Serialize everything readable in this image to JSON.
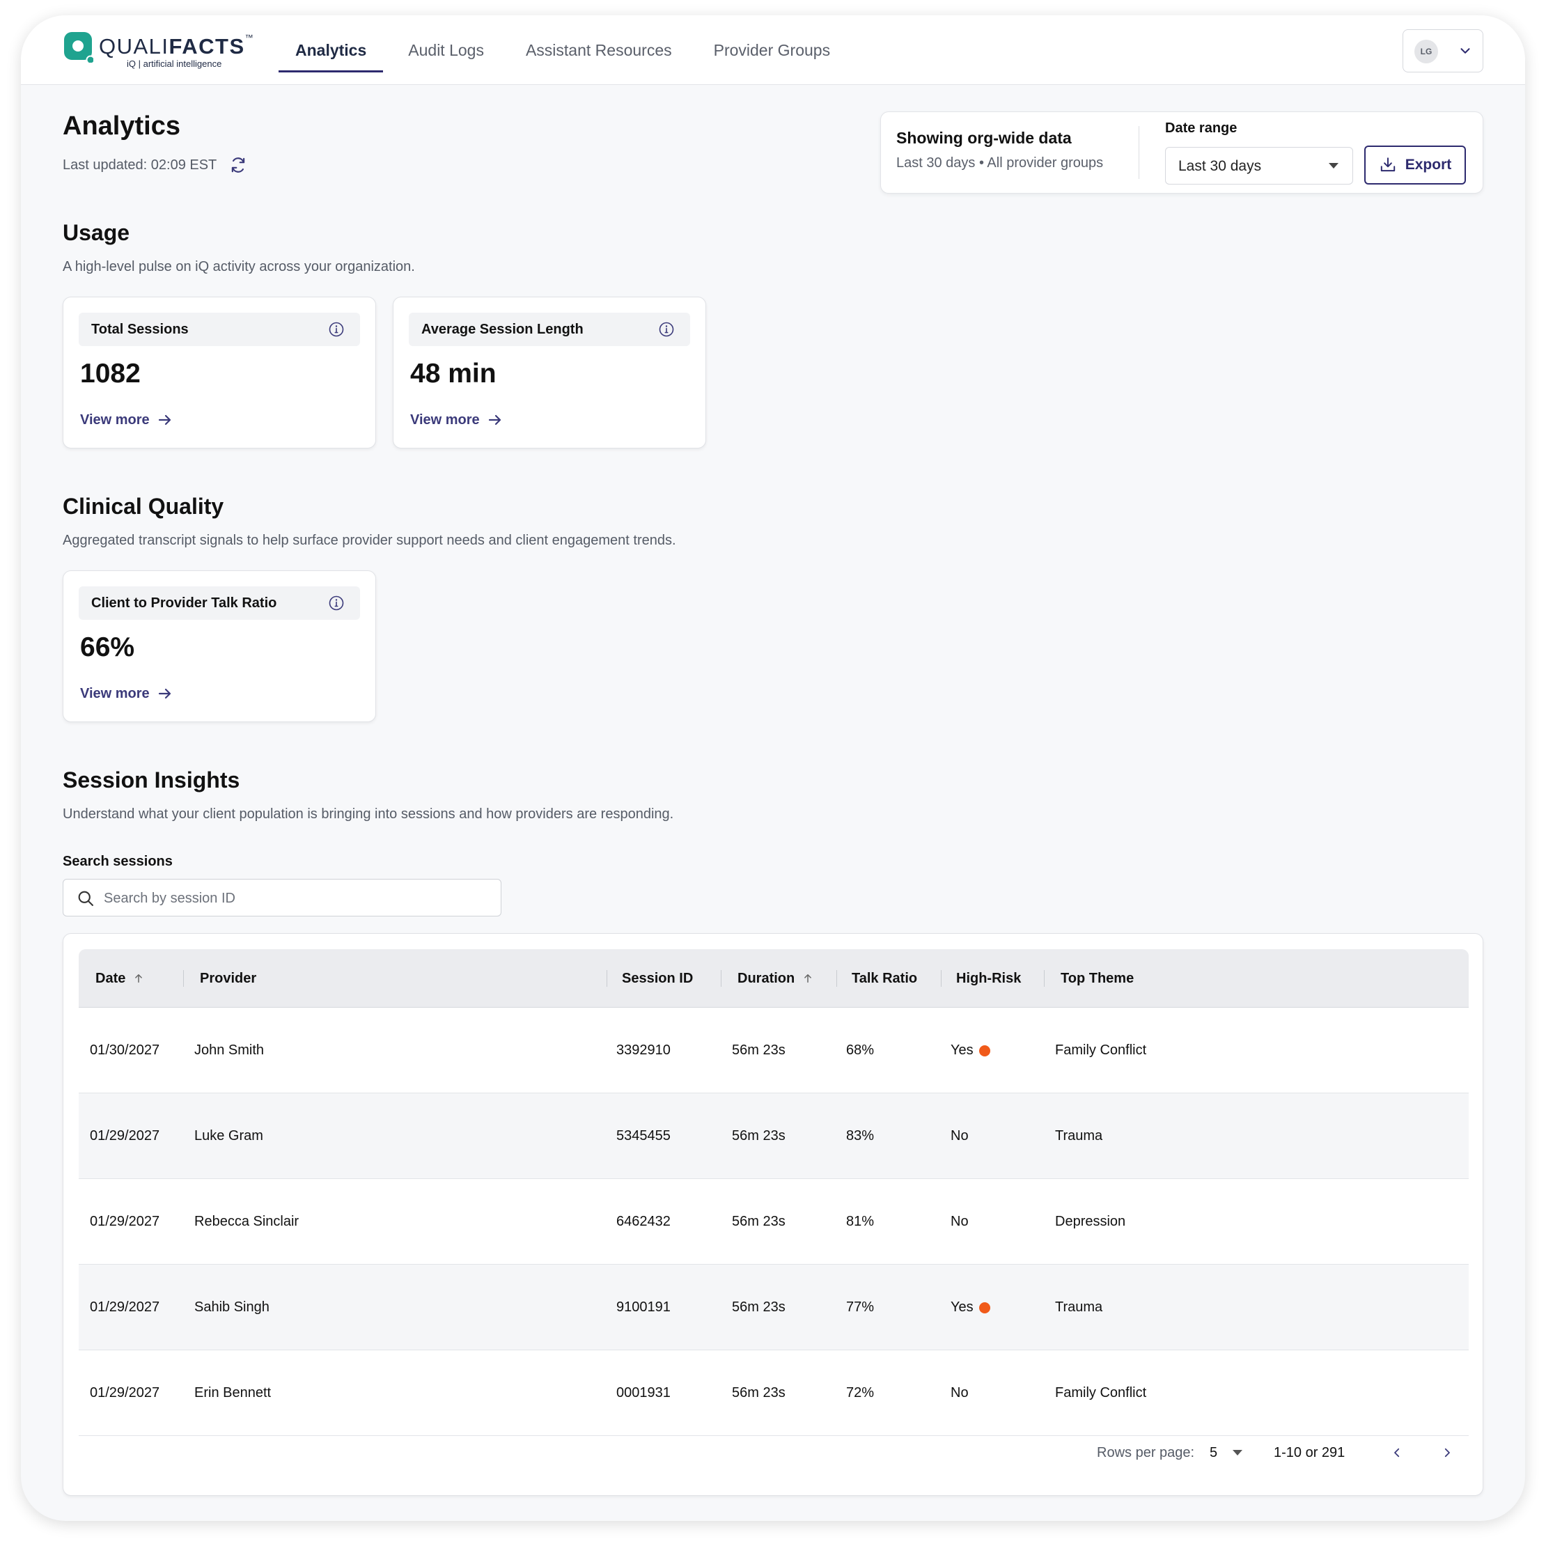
{
  "brand": {
    "name_light": "QUALI",
    "name_bold": "FACTS",
    "trademark": "™",
    "tagline": "iQ | artificial intelligence",
    "accent": "#1fa38f"
  },
  "nav": {
    "tabs": [
      {
        "label": "Analytics",
        "active": true
      },
      {
        "label": "Audit Logs",
        "active": false
      },
      {
        "label": "Assistant Resources",
        "active": false
      },
      {
        "label": "Provider Groups",
        "active": false
      }
    ],
    "user_initials": "LG",
    "active_color": "#2d2a6e"
  },
  "header": {
    "title": "Analytics",
    "last_updated": "Last updated: 02:09 EST"
  },
  "filters": {
    "title": "Showing org-wide data",
    "subtitle": "Last 30 days • All provider groups",
    "date_range_label": "Date range",
    "date_range_value": "Last 30 days",
    "export_label": "Export"
  },
  "usage": {
    "title": "Usage",
    "description": "A high-level pulse on iQ activity across your organization.",
    "cards": [
      {
        "label": "Total Sessions",
        "value": "1082",
        "link": "View more"
      },
      {
        "label": "Average Session Length",
        "value": "48 min",
        "link": "View more"
      }
    ]
  },
  "clinical": {
    "title": "Clinical Quality",
    "description": "Aggregated transcript signals to help surface provider support needs and client engagement trends.",
    "cards": [
      {
        "label": "Client to Provider Talk Ratio",
        "value": "66%",
        "link": "View more"
      }
    ]
  },
  "insights": {
    "title": "Session Insights",
    "description": "Understand what your client population is bringing into sessions and how providers are responding.",
    "search_label": "Search sessions",
    "search_placeholder": "Search by session ID",
    "search_value": ""
  },
  "table": {
    "columns": [
      "Date",
      "Provider",
      "Session ID",
      "Duration",
      "Talk Ratio",
      "High-Risk",
      "Top Theme"
    ],
    "rows": [
      {
        "date": "01/30/2027",
        "provider": "John Smith",
        "session_id": "3392910",
        "duration": "56m 23s",
        "talk_ratio": "68%",
        "high_risk": "Yes",
        "risk_flag": true,
        "theme": "Family Conflict"
      },
      {
        "date": "01/29/2027",
        "provider": "Luke Gram",
        "session_id": "5345455",
        "duration": "56m 23s",
        "talk_ratio": "83%",
        "high_risk": "No",
        "risk_flag": false,
        "theme": "Trauma"
      },
      {
        "date": "01/29/2027",
        "provider": "Rebecca Sinclair",
        "session_id": "6462432",
        "duration": "56m 23s",
        "talk_ratio": "81%",
        "high_risk": "No",
        "risk_flag": false,
        "theme": "Depression"
      },
      {
        "date": "01/29/2027",
        "provider": "Sahib Singh",
        "session_id": "9100191",
        "duration": "56m 23s",
        "talk_ratio": "77%",
        "high_risk": "Yes",
        "risk_flag": true,
        "theme": "Trauma"
      },
      {
        "date": "01/29/2027",
        "provider": "Erin Bennett",
        "session_id": "0001931",
        "duration": "56m 23s",
        "talk_ratio": "72%",
        "high_risk": "No",
        "risk_flag": false,
        "theme": "Family Conflict"
      }
    ],
    "risk_color": "#f05a1a",
    "pagination": {
      "rows_per_page_label": "Rows per page:",
      "rows_per_page": "5",
      "range": "1-10 or 291"
    }
  }
}
